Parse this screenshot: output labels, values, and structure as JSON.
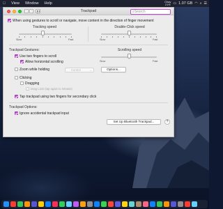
{
  "menubar": {
    "items": [
      "View",
      "Window",
      "Help"
    ],
    "battery_status": "Chạy",
    "battery_percent": "21%",
    "memory": "1.07 GB",
    "icons": [
      "apple-menu-icon",
      "battery-icon",
      "wifi-icon",
      "search-icon",
      "control-center-icon"
    ]
  },
  "window": {
    "title": "Trackpad",
    "search_placeholder": "Search",
    "top_option": "When using gestures to scroll or navigate, move content in the direction of finger movement",
    "tracking_speed": {
      "label": "Tracking speed",
      "min": "Slow",
      "max": "Fast",
      "level": 0.45
    },
    "double_click_speed": {
      "label": "Double-Click speed",
      "min": "Slow",
      "max": "Fast",
      "level": 0.5
    },
    "gestures": {
      "heading": "Trackpad Gestures:",
      "two_fingers_scroll": "Use two fingers to scroll",
      "horizontal_scrolling": "Allow horizontal scrolling",
      "zoom_while_holding": "Zoom while holding",
      "zoom_modifier": "Control",
      "options_button": "Options...",
      "scrolling_speed": {
        "label": "Scrolling speed",
        "min": "Slow",
        "max": "Fast",
        "level": 0.5
      },
      "clicking": "Clicking",
      "dragging": "Dragging",
      "drag_lock": "Drag Lock (tap again to release)",
      "tap_secondary": "Tap trackpad using two fingers for secondary click"
    },
    "options": {
      "heading": "Trackpad Options:",
      "ignore_accidental": "Ignore accidental trackpad input",
      "bluetooth_button": "Set Up Bluetooth Trackpad...",
      "help": "?"
    }
  },
  "colors": {
    "accent": "#c14fd6",
    "window_bg": "#ececec",
    "menubar_bg": "#1f2230"
  },
  "dock": {
    "apps": [
      "#1e90ff",
      "#ff3b30",
      "#34c759",
      "#ff9500",
      "#5856d6",
      "#ffcc00",
      "#0a84ff",
      "#ff2d55",
      "#30d158",
      "#64d2ff",
      "#bf5af2",
      "#ff9f0a",
      "#8e8e93",
      "#0a84ff",
      "#32d74b",
      "#ff453a",
      "#5e5ce6",
      "#ffd60a",
      "#66d4cf",
      "#ac8e68",
      "#ff6482",
      "#0a84ff",
      "#34c759",
      "#ff9500",
      "#5856d6",
      "#8e8e93",
      "#ff3b30",
      "#64d2ff"
    ]
  }
}
